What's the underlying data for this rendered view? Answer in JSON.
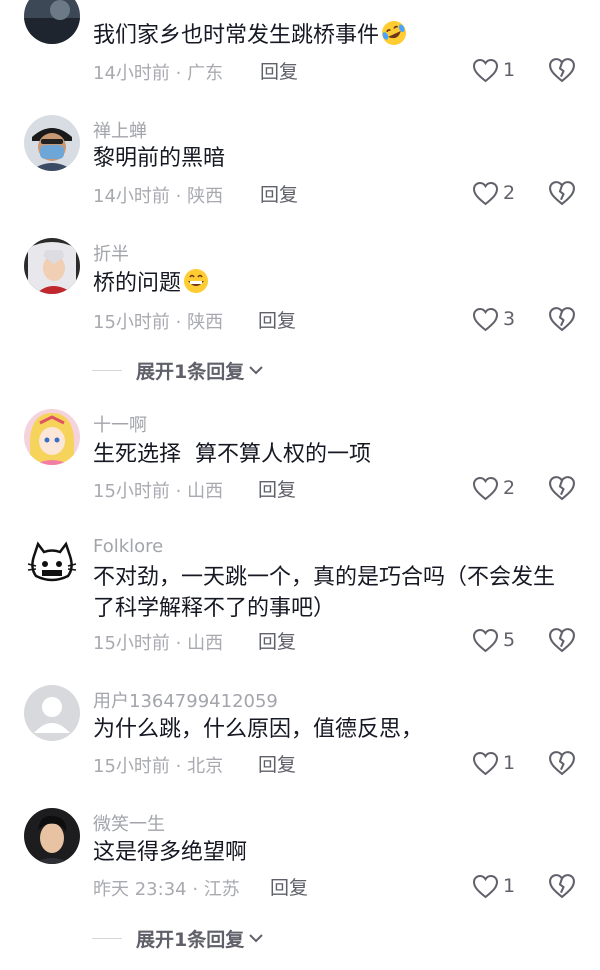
{
  "reply_label": "回复",
  "expand_label": "展开1条回复",
  "comments": [
    {
      "username": "",
      "text": "我们家乡也时常发生跳桥事件",
      "emoji": "rolling-laughing-emoji",
      "meta": "14小时前 · 广东",
      "likes": "1"
    },
    {
      "username": "禅上蝉",
      "text": "黎明前的黑暗",
      "meta": "14小时前 · 陕西",
      "likes": "2"
    },
    {
      "username": "折半",
      "text": "桥的问题",
      "emoji": "grinning-emoji",
      "meta": "15小时前 · 陕西",
      "likes": "3"
    },
    {
      "username": "十一啊",
      "text": "生死选择  算不算人权的一项",
      "meta": "15小时前 · 山西",
      "likes": "2"
    },
    {
      "username": "Folklore",
      "text": "不对劲，一天跳一个，真的是巧合吗（不会发生了科学解释不了的事吧）",
      "meta": "15小时前 · 山西",
      "likes": "5"
    },
    {
      "username": "用户1364799412059",
      "text": "为什么跳，什么原因，值德反思，",
      "meta": "15小时前 · 北京",
      "likes": "1"
    },
    {
      "username": "微笑一生",
      "text": "这是得多绝望啊",
      "meta": "昨天 23:34 · 江苏",
      "likes": "1"
    }
  ],
  "icons": {
    "like": "heart-outline-icon",
    "dislike": "broken-heart-icon",
    "expand": "chevron-down-icon"
  },
  "colors": {
    "primary_text": "#161823",
    "secondary_text": "#a3a5ab",
    "action_text": "#5f6069"
  }
}
